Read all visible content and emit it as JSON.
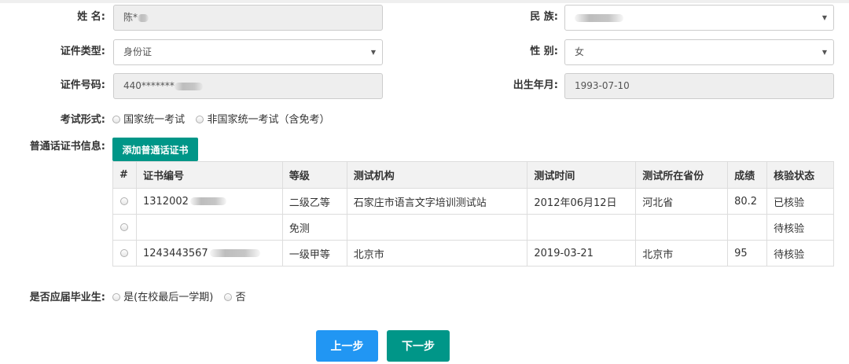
{
  "form": {
    "name": {
      "label": "姓 名:",
      "value": "陈*"
    },
    "ethnicity": {
      "label": "民 族:"
    },
    "id_type": {
      "label": "证件类型:",
      "value": "身份证"
    },
    "gender": {
      "label": "性 别:",
      "value": "女"
    },
    "id_number": {
      "label": "证件号码:",
      "value": "440*******"
    },
    "birth": {
      "label": "出生年月:",
      "value": "1993-07-10"
    },
    "exam_form": {
      "label": "考试形式:",
      "options": [
        "国家统一考试",
        "非国家统一考试（含免考）"
      ]
    },
    "mandarin": {
      "label": "普通话证书信息:",
      "add_button": "添加普通话证书"
    },
    "graduate": {
      "label": "是否应届毕业生:",
      "options": [
        "是(在校最后一学期)",
        "否"
      ]
    }
  },
  "certificate_table": {
    "headers": [
      "#",
      "证书编号",
      "等级",
      "测试机构",
      "测试时间",
      "测试所在省份",
      "成绩",
      "核验状态"
    ],
    "rows": [
      {
        "number": "1312002",
        "level": "二级乙等",
        "agency": "石家庄市语言文字培训测试站",
        "date": "2012年06月12日",
        "province": "河北省",
        "score": "80.2",
        "status": "已核验"
      },
      {
        "number": "",
        "level": "免测",
        "agency": "",
        "date": "",
        "province": "",
        "score": "",
        "status": "待核验"
      },
      {
        "number": "1243443567",
        "level": "一级甲等",
        "agency": "北京市",
        "date": "2019-03-21",
        "province": "北京市",
        "score": "95",
        "status": "待核验"
      }
    ]
  },
  "nav": {
    "prev": "上一步",
    "next": "下一步"
  },
  "colors": {
    "teal": "#009688",
    "blue": "#2196f3",
    "field_bg": "#eeeeee",
    "border": "#cccccc"
  }
}
